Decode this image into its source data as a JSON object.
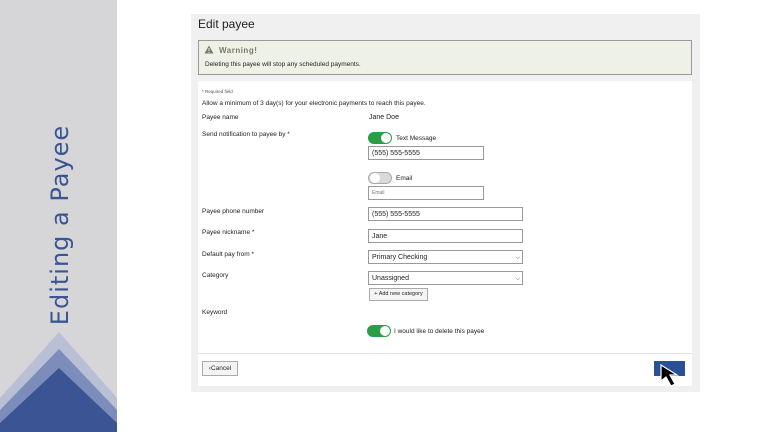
{
  "sidebar": {
    "title": "Editing a Payee",
    "color": "#3b5594"
  },
  "page": {
    "title": "Edit payee"
  },
  "warning": {
    "icon": "warning-triangle-icon",
    "title": "Warning!",
    "message": "Deleting this payee will stop any scheduled payments."
  },
  "form": {
    "required_note": "* Required field",
    "min_days_text": "Allow a minimum of 3 day(s) for your electronic payments to reach this payee.",
    "payee_name_label": "Payee name",
    "payee_name_value": "Jane Doe",
    "notification_label": "Send notification to payee by *",
    "text_message_label": "Text Message",
    "text_message_enabled": true,
    "text_message_value": "(555) 555-5555",
    "email_label": "Email",
    "email_enabled": false,
    "email_placeholder": "Email",
    "phone_label": "Payee phone number",
    "phone_value": "(555) 555-5555",
    "nickname_label": "Payee nickname *",
    "nickname_value": "Jane",
    "pay_from_label": "Default pay from *",
    "pay_from_value": "Primary Checking",
    "category_label": "Category",
    "category_value": "Unassigned",
    "add_category_label": "+ Add new category",
    "keyword_label": "Keyword",
    "delete_label": "I would like to delete this payee",
    "delete_enabled": true
  },
  "footer": {
    "cancel_label": "Cancel",
    "save_color": "#2b4f95"
  },
  "colors": {
    "toggle_on": "#2a9d47",
    "accent": "#2b4f95"
  }
}
